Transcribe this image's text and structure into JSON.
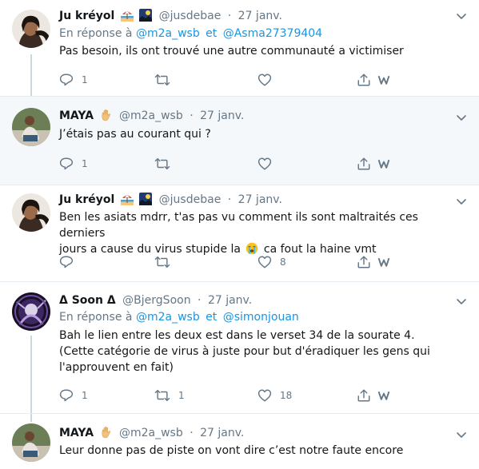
{
  "tweets": [
    {
      "name": "Ju kréyol",
      "handle": "@jusdebae",
      "sep": "·",
      "date": "27 janv.",
      "replying_prefix": "En réponse à",
      "mention1": "@m2a_wsb",
      "joiner": "et",
      "mention2": "@Asma27379404",
      "text": "Pas besoin, ils ont trouvé une autre communauté a victimiser",
      "reply_count": "1",
      "retweet_count": "",
      "like_count": ""
    },
    {
      "name": "MAYA",
      "handle": "@m2a_wsb",
      "sep": "·",
      "date": "27 janv.",
      "text": "J’étais pas au courant qui ?",
      "reply_count": "1",
      "retweet_count": "",
      "like_count": ""
    },
    {
      "name": "Ju kréyol",
      "handle": "@jusdebae",
      "sep": "·",
      "date": "27 janv.",
      "text_line1": "Ben les asiats mdrr, t'as pas vu comment ils sont maltraités ces derniers",
      "text_line2a": "jours a cause du virus stupide la",
      "text_line2b": "ca fout la haine vmt",
      "reply_count": "",
      "retweet_count": "",
      "like_count": "8"
    },
    {
      "name": "Δ Soon Δ",
      "handle": "@BjergSoon",
      "sep": "·",
      "date": "27 janv.",
      "replying_prefix": "En réponse à",
      "mention1": "@m2a_wsb",
      "joiner": "et",
      "mention2": "@simonjouan",
      "text_line1": "Bah le lien entre les deux est dans le verset 34 de la sourate 4.",
      "text_line2": "(Cette catégorie de virus à juste pour but d'éradiquer les gens qui",
      "text_line3": "l'approuvent en fait)",
      "reply_count": "1",
      "retweet_count": "1",
      "like_count": "18"
    },
    {
      "name": "MAYA",
      "handle": "@m2a_wsb",
      "sep": "·",
      "date": "27 janv.",
      "text": "Leur donne pas de piste on vont dire c’est notre faute encore"
    }
  ],
  "colors": {
    "text": "#14171a",
    "secondary": "#657786",
    "link": "#1b95e0",
    "highlight_bg": "#f5f8fa",
    "divider": "#e6ecf0",
    "thread_line": "#ccd6dd"
  },
  "icons": [
    "chevron-down-icon",
    "reply-icon",
    "retweet-icon",
    "like-icon",
    "share-icon",
    "instapaper-icon",
    "beach-emoji-icon",
    "moon-photo-emoji-icon",
    "raised-hand-emoji-icon",
    "crying-face-emoji-icon"
  ]
}
